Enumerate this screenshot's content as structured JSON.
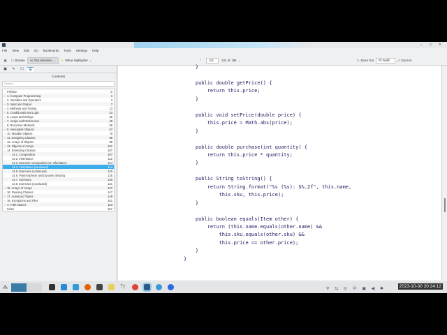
{
  "window": {
    "controls": "⌄ ◇ ✕"
  },
  "menu": [
    "File",
    "View",
    "Edit",
    "Go",
    "Bookmarks",
    "Tools",
    "Settings",
    "Help"
  ],
  "toolbar": {
    "browse": "Browse",
    "text_selection": "Text Selection",
    "highlighter": "Yellow Highlighter",
    "page_input": "116",
    "page_label": "126",
    "of": "of",
    "total": "199",
    "zoom_out": "Zoom Out",
    "zoom_mode": "Fit Width",
    "zoom_in": "Zoom In"
  },
  "sidebar": {
    "title": "Contents",
    "search_placeholder": "Search...",
    "items": [
      {
        "label": "Preface",
        "page": "ix",
        "level": 0,
        "arrow": ""
      },
      {
        "label": "1. Computer Programming",
        "page": "1",
        "level": 0,
        "arrow": "›"
      },
      {
        "label": "2. Variables and Operators",
        "page": "3",
        "level": 0,
        "arrow": "›"
      },
      {
        "label": "3. Input and Output",
        "page": "7",
        "level": 0,
        "arrow": "›"
      },
      {
        "label": "4. Methods and Testing",
        "page": "13",
        "level": 0,
        "arrow": "›"
      },
      {
        "label": "5. Conditionals and Logic",
        "page": "23",
        "level": 0,
        "arrow": "›"
      },
      {
        "label": "6. Loops and Strings",
        "page": "35",
        "level": 0,
        "arrow": "›"
      },
      {
        "label": "7. Arrays and References",
        "page": "49",
        "level": 0,
        "arrow": "›"
      },
      {
        "label": "8. Recursive Methods",
        "page": "59",
        "level": 0,
        "arrow": "›"
      },
      {
        "label": "9. Immutable Objects",
        "page": "67",
        "level": 0,
        "arrow": "›"
      },
      {
        "label": "10. Mutable Objects",
        "page": "79",
        "level": 0,
        "arrow": "›"
      },
      {
        "label": "11. Designing Classes",
        "page": "85",
        "level": 0,
        "arrow": "›"
      },
      {
        "label": "12. Arrays of Objects",
        "page": "95",
        "level": 0,
        "arrow": "›"
      },
      {
        "label": "13. Objects of Arrays",
        "page": "101",
        "level": 0,
        "arrow": "›"
      },
      {
        "label": "14. Extending Classes",
        "page": "107",
        "level": 0,
        "arrow": "⌄"
      },
      {
        "label": "14.1. Composition",
        "page": "107",
        "level": 1,
        "arrow": ""
      },
      {
        "label": "14.2. Inheritance",
        "page": "112",
        "level": 1,
        "arrow": ""
      },
      {
        "label": "14.3. Exercise: Composition vs. Inheritance",
        "page": "114",
        "level": 1,
        "arrow": ""
      },
      {
        "label": "14.4. Inheritance (continued)",
        "page": "114",
        "level": 1,
        "arrow": "",
        "selected": true
      },
      {
        "label": "14.5. Exercises (continued)",
        "page": "120",
        "level": 1,
        "arrow": ""
      },
      {
        "label": "14.6. Polymorphism and Dynamic Binding",
        "page": "125",
        "level": 1,
        "arrow": ""
      },
      {
        "label": "14.7. Summary",
        "page": "130",
        "level": 1,
        "arrow": ""
      },
      {
        "label": "14.8. Exercises (concluded)",
        "page": "131",
        "level": 1,
        "arrow": ""
      },
      {
        "label": "15. Arrays of Arrays",
        "page": "137",
        "level": 0,
        "arrow": "›"
      },
      {
        "label": "16. Reusing Classes",
        "page": "147",
        "level": 0,
        "arrow": "›"
      },
      {
        "label": "17. Advanced Topics",
        "page": "149",
        "level": 0,
        "arrow": "›"
      },
      {
        "label": "18. Exceptions and Files",
        "page": "151",
        "level": 0,
        "arrow": "›"
      },
      {
        "label": "A. Path Names",
        "page": "163",
        "level": 0,
        "arrow": "›"
      },
      {
        "label": "Index",
        "page": "167",
        "level": 0,
        "arrow": ""
      }
    ]
  },
  "code": [
    "    }",
    "",
    "    public double getPrice() {",
    "        return this.price;",
    "    }",
    "",
    "    public void setPrice(double price) {",
    "        this.price = Math.abs(price);",
    "    }",
    "",
    "    public double purchase(int quantity) {",
    "        return this.price * quantity;",
    "    }",
    "",
    "    public String toString() {",
    "        return String.format(\"%s (%s): $%.2f\", this.name,",
    "            this.sku, this.price);",
    "    }",
    "",
    "    public boolean equals(Item other) {",
    "        return (this.name.equals(other.name) &&",
    "            this.sku.equals(other.sku) &&",
    "            this.price == other.price);",
    "    }",
    "}"
  ],
  "taskbar": {
    "clock": "2023-10-30 20:24:12"
  }
}
